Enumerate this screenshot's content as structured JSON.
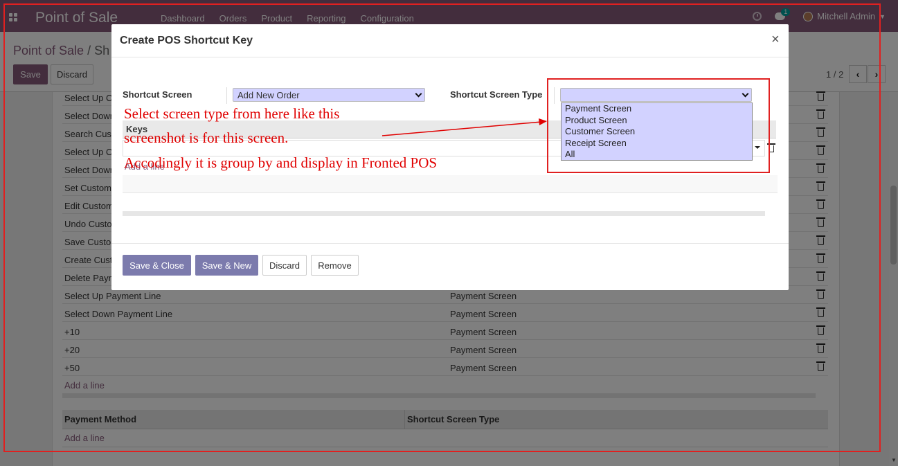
{
  "navbar": {
    "app_title": "Point of Sale",
    "menu": [
      "Dashboard",
      "Orders",
      "Product",
      "Reporting",
      "Configuration"
    ],
    "chat_count": "1",
    "user": "Mitchell Admin"
  },
  "control_panel": {
    "breadcrumb_root": "Point of Sale",
    "breadcrumb_sep": "/",
    "breadcrumb_current": "Sh",
    "save_label": "Save",
    "discard_label": "Discard",
    "pager": "1 / 2"
  },
  "background_rows": [
    {
      "name": "Select Up C",
      "type": ""
    },
    {
      "name": "Select Down",
      "type": ""
    },
    {
      "name": "Search Cus",
      "type": ""
    },
    {
      "name": "Select Up O",
      "type": ""
    },
    {
      "name": "Select Down",
      "type": ""
    },
    {
      "name": "Set Custom",
      "type": ""
    },
    {
      "name": "Edit Custom",
      "type": ""
    },
    {
      "name": "Undo Custo",
      "type": ""
    },
    {
      "name": "Save Custo",
      "type": ""
    },
    {
      "name": "Create Cust",
      "type": ""
    },
    {
      "name": "Delete Payn",
      "type": ""
    },
    {
      "name": "Select Up Payment Line",
      "type": "Payment Screen"
    },
    {
      "name": "Select Down Payment Line",
      "type": "Payment Screen"
    },
    {
      "name": "+10",
      "type": "Payment Screen"
    },
    {
      "name": "+20",
      "type": "Payment Screen"
    },
    {
      "name": "+50",
      "type": "Payment Screen"
    }
  ],
  "background": {
    "add_line": "Add a line",
    "payment_table": {
      "col1": "Payment Method",
      "col2": "Shortcut Screen Type",
      "add_line": "Add a line"
    }
  },
  "modal": {
    "title": "Create POS Shortcut Key",
    "close": "×",
    "shortcut_screen_label": "Shortcut Screen",
    "shortcut_screen_value": "Add New Order",
    "shortcut_screen_type_label": "Shortcut Screen Type",
    "shortcut_screen_type_value": "",
    "keys_header": "Keys",
    "keys_add_line": "Add a line",
    "dropdown_options": [
      "Payment Screen",
      "Product Screen",
      "Customer Screen",
      "Receipt Screen",
      "All"
    ],
    "buttons": {
      "save_close": "Save & Close",
      "save_new": "Save & New",
      "discard": "Discard",
      "remove": "Remove"
    }
  },
  "annotation": {
    "line1": "Select screen type from here like this",
    "line2": "screenshot is for this screen.",
    "line3": "Accodingly it is group by and display in Fronted POS",
    "color": "#e00000"
  },
  "colors": {
    "brand": "#875a7b",
    "primary_button": "#7c7bad",
    "select_bg": "#d2d2ff"
  }
}
